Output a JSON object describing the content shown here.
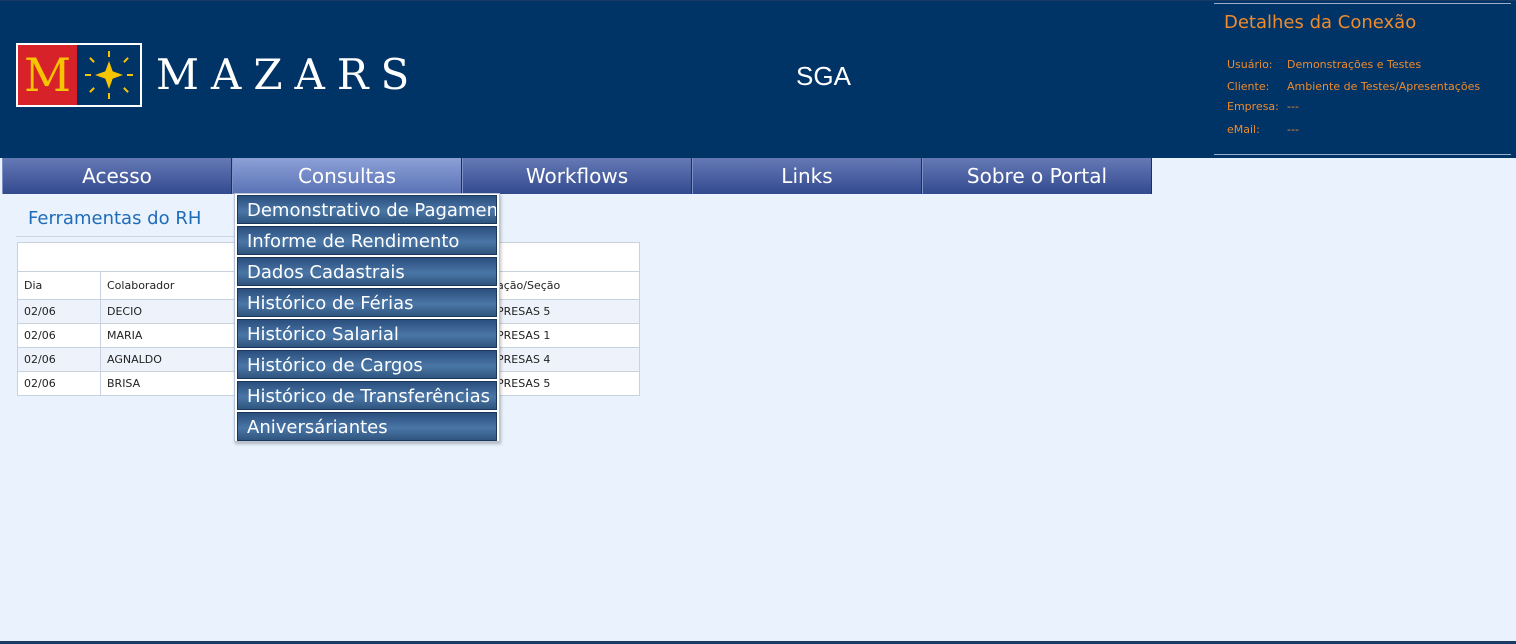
{
  "header": {
    "logo": {
      "letter": "M",
      "word": "MAZARS"
    },
    "app_title": "SGA",
    "connection": {
      "title": "Detalhes da Conexão",
      "rows": [
        {
          "label": "Usuário:",
          "value": "Demonstrações e Testes"
        },
        {
          "label": "Cliente:",
          "value": "Ambiente de Testes/Apresentações"
        },
        {
          "label": "Empresa:",
          "value": "---"
        },
        {
          "label": "eMail:",
          "value": "---"
        }
      ]
    }
  },
  "menu": [
    {
      "label": "Acesso"
    },
    {
      "label": "Consultas"
    },
    {
      "label": "Workflows"
    },
    {
      "label": "Links"
    },
    {
      "label": "Sobre o Portal"
    }
  ],
  "dropdown": [
    "Demonstrativo de Pagamento",
    "Informe de Rendimento",
    "Dados Cadastrais",
    "Histórico de Férias",
    "Histórico Salarial",
    "Histórico de Cargos",
    "Histórico de Transferências",
    "Aniversáriantes"
  ],
  "section": {
    "title": "Ferramentas do RH"
  },
  "table": {
    "headers": [
      "Dia",
      "Colaborador",
      "ação/Seção"
    ],
    "rows": [
      [
        "02/06",
        "DECIO",
        "PRESAS 5"
      ],
      [
        "02/06",
        "MARIA",
        "PRESAS 1"
      ],
      [
        "02/06",
        "AGNALDO",
        "PRESAS 4"
      ],
      [
        "02/06",
        "BRISA",
        "PRESAS 5"
      ]
    ]
  },
  "colors": {
    "header_bg": "#003366",
    "accent_orange": "#ef8b2c",
    "page_bg": "#e9f2fd",
    "logo_red": "#d8222a",
    "logo_yellow": "#f6c400"
  }
}
